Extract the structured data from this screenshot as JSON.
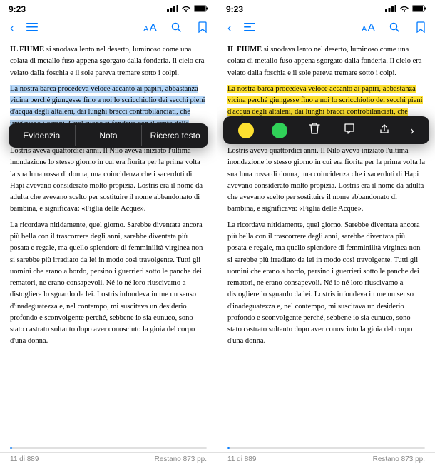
{
  "screens": [
    {
      "id": "left-screen",
      "status": {
        "time": "9:23",
        "signal": "▎▎▎",
        "wifi": "wifi",
        "battery": "🔋"
      },
      "nav": {
        "back_label": "‹",
        "menu_label": "≡",
        "font_label_small": "A",
        "font_label_big": "A",
        "search_label": "🔍",
        "bookmark_label": "🔖"
      },
      "context_menu": {
        "items": [
          "Evidenzia",
          "Nota",
          "Ricerca testo"
        ]
      },
      "text_paragraphs": [
        "IL FIUME si snodava lento nel deserto, luminoso come una colata di metallo fuso appena sgorgato dalla fonderia. Il cielo era velato dalla foschia e il sole pareva tremare sotto i colpi.",
        "La nostra barca procedeva veloce accanto ai papiri, abbastanza vicina perché giungesse fino a noi lo scricchiolio dei secchi pieni d'acqua degli altaleni, dai lunghi bracci controbilanciati, che irrigavano i campi. Quel suono si fondeva con il canto della ragazza seduta a prua.",
        "Lostris aveva quattordici anni. Il Nilo aveva iniziato l'ultima inondazione lo stesso giorno in cui era fiorita per la prima volta la sua luna rossa di donna, una coincidenza che i sacerdoti di Hapi avevano considerato molto propizia. Lostris era il nome da adulta che avevano scelto per sostituire il nome abbandonato di bambina, e significava: «Figlia delle Acque».",
        "La ricordava nitidamente, quel giorno. Sarebbe diventata ancora più bella con il trascorrere degli anni, sarebbe diventata più posata e regale, ma quello splendore di femminilità virginea non si sarebbe più irradiato da lei in modo così travolgente. Tutti gli uomini che erano a bordo, persino i guerrieri sotto le panche dei rematori, ne erano consapevoli. Né io né loro riuscivamo a distogliere lo sguardo da lei. Lostris infondeva in me un senso d'inadeguatezza e, nel contempo, mi suscitava un desiderio profondo e sconvolgente perché, sebbene io sia eunuco, sono stato castrato soltanto dopo aver conosciuto la gioia del corpo d'una donna."
      ],
      "highlighted_text": "La nostra barca procedeva veloce accanto ai papiri, abbastanza vicina perché giungesse fino a noi lo scricchiolio dei secchi pieni d'acqua degli altaleni, dai lunghi bracci controbilanciati, che irrigavano i campi. Quel suono si fondeva con il canto della ragazza seduta a prua.",
      "footer": {
        "page": "11 di 889",
        "remaining": "Restano 873 pp.",
        "progress": 1.2
      }
    },
    {
      "id": "right-screen",
      "status": {
        "time": "9:23"
      },
      "nav": {
        "back_label": "‹",
        "menu_label": "⋮",
        "font_label_small": "A",
        "font_label_big": "A",
        "search_label": "🔍",
        "bookmark_label": "🔖"
      },
      "annotation_bar": {
        "color1": "yellow",
        "color2": "green",
        "delete_icon": "🗑",
        "note_icon": "💬",
        "share_icon": "⬆",
        "chevron": "›"
      },
      "text_paragraphs": [
        "IL FIUME si snodava lento nel deserto, luminoso come una colata di metallo fuso appena sgorgato dalla fonderia. Il cielo era velato dalla foschia e il sole pareva tremare sotto i colpi.",
        "La nostra barca procedeva veloce accanto ai papiri, abbastanza vicina perché giungesse fino a noi lo scricchiolio dei secchi pieni d'acqua degli altaleni, dai lunghi bracci controbilanciati, che irrigavano i campi. Quel suono si fondeva con il canto della ragazza seduta a prua.",
        "Lostris aveva quattordici anni. Il Nilo aveva iniziato l'ultima inondazione lo stesso giorno in cui era fiorita per la prima volta la sua luna rossa di donna, una coincidenza che i sacerdoti di Hapi avevano considerato molto propizia. Lostris era il nome da adulta che avevano scelto per sostituire il nome abbandonato di bambina, e significava: «Figlia delle Acque».",
        "La ricordava nitidamente, quel giorno. Sarebbe diventata ancora più bella con il trascorrere degli anni, sarebbe diventata più posata e regale, ma quello splendore di femminilità virginea non si sarebbe più irradiato da lei in modo così travolgente. Tutti gli uomini che erano a bordo, persino i guerrieri sotto le panche dei rematori, ne erano consapevoli. Né io né loro riuscivamo a distogliere lo sguardo da lei. Lostris infondeva in me un senso d'inadeguatezza e, nel contempo, mi suscitava un desiderio profondo e sconvolgente perché, sebbene io sia eunuco, sono stato castrato soltanto dopo aver conosciuto la gioia del corpo d'una donna."
      ],
      "footer": {
        "page": "11 di 889",
        "remaining": "Restano 873 pp.",
        "progress": 1.2
      }
    }
  ]
}
